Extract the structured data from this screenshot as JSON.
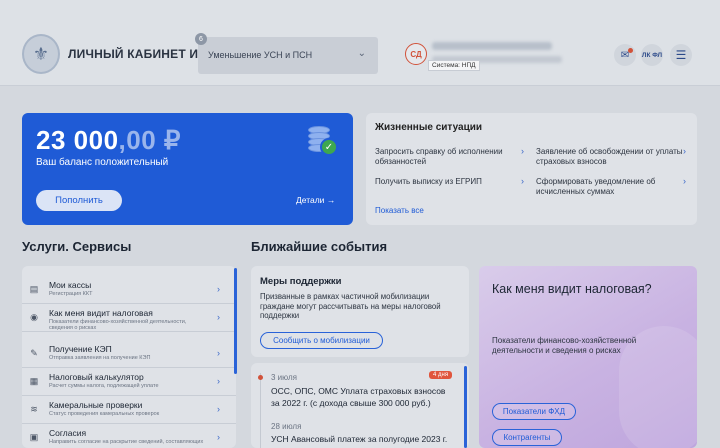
{
  "header": {
    "app_title": "ЛИЧНЫЙ КАБИНЕТ ИП",
    "logo_icon": "fns-emblem-icon",
    "select": {
      "badge": "6",
      "value": "Уменьшение УСН и ПСН"
    },
    "avatar_initials": "СД",
    "tooltip": "Система: НПД",
    "lk_fl": "ЛК ФЛ",
    "accent": "#d1523a"
  },
  "balance": {
    "amount_main": "23 000",
    "amount_cents": ",00 ₽",
    "label": "Ваш баланс положительный",
    "pay_button": "Пополнить",
    "details": "Детали",
    "color": "#1f5bd6"
  },
  "life": {
    "title": "Жизненные ситуации",
    "items": [
      "Запросить справку об исполнении обязанностей",
      "Заявление об освобождении от уплаты страховых взносов",
      "Получить выписку из ЕГРИП",
      "Сформировать уведомление об исчисленных суммах"
    ],
    "show_all": "Показать все"
  },
  "services": {
    "title": "Услуги. Сервисы",
    "items": [
      {
        "title": "Мои кассы",
        "sub": "Регистрация ККТ",
        "icon": "cash-register-icon"
      },
      {
        "title": "Как меня видит налоговая",
        "sub": "Показатели финансово-хозяйственной деятельности, сведения о рисках",
        "icon": "profile-icon"
      },
      {
        "title": "Получение КЭП",
        "sub": "Отправка заявления на получение КЭП",
        "icon": "signature-icon"
      },
      {
        "title": "Налоговый калькулятор",
        "sub": "Расчет суммы налога, подлежащей уплате",
        "icon": "calculator-icon"
      },
      {
        "title": "Камеральные проверки",
        "sub": "Статус проведения камеральных проверок",
        "icon": "inspection-icon"
      },
      {
        "title": "Согласия",
        "sub": "Направить согласие на раскрытие сведений, составляющих",
        "icon": "consent-icon"
      }
    ]
  },
  "events": {
    "title": "Ближайшие события",
    "support": {
      "title": "Меры поддержки",
      "desc": "Призванные в рамках частичной мобилизации граждане могут рассчитывать на меры налоговой поддержки",
      "button": "Сообщить о мобилизации"
    },
    "list": [
      {
        "date": "3 июля",
        "badge": "4 дня",
        "text": "ОСС, ОПС, ОМС Уплата страховых взносов за 2022 г. (с дохода свыше 300 000 руб.)"
      },
      {
        "date": "28 июля",
        "text": "УСН Авансовый платеж за полугодие 2023 г."
      }
    ]
  },
  "tax": {
    "title": "Как меня видит налоговая?",
    "desc": "Показатели финансово-хозяйственной деятельности и сведения о рисках",
    "btn1": "Показатели ФХД",
    "btn2": "Контрагенты"
  }
}
